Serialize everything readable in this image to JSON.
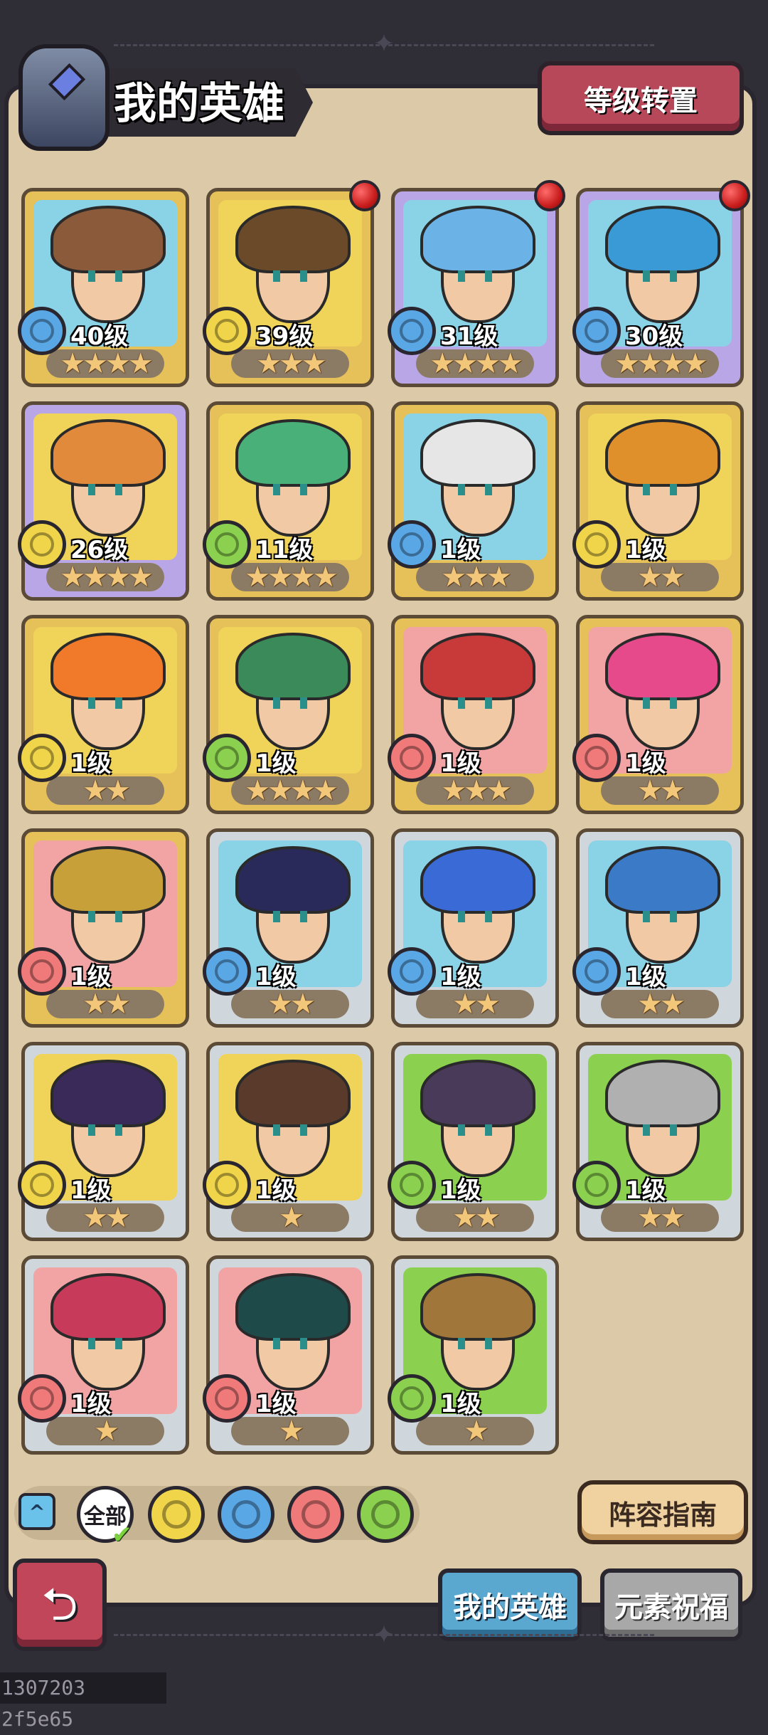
{
  "header": {
    "title": "我的英雄",
    "level_transfer_button": "等级转置"
  },
  "elements": {
    "earth": {
      "color": "#f0d54a",
      "icon": "earth-swirl-icon"
    },
    "water": {
      "color": "#5aa7e6",
      "icon": "water-drop-icon"
    },
    "fire": {
      "color": "#f07a7a",
      "icon": "fire-flame-icon"
    },
    "wind": {
      "color": "#8bd14f",
      "icon": "wind-swirl-icon"
    }
  },
  "heroes": [
    {
      "level": "40级",
      "stars": "★★★★",
      "element": "water",
      "bg": "#8ad2e6",
      "hair": "#8a5a3a",
      "frame": "#e6c15a",
      "red_dot": false
    },
    {
      "level": "39级",
      "stars": "★★★",
      "element": "earth",
      "bg": "#f0d45a",
      "hair": "#6b4a2a",
      "frame": "#e6c15a",
      "red_dot": true
    },
    {
      "level": "31级",
      "stars": "★★★★",
      "element": "water",
      "bg": "#8ad2e6",
      "hair": "#6bb3e6",
      "frame": "#b9a6e6",
      "red_dot": true
    },
    {
      "level": "30级",
      "stars": "★★★★",
      "element": "water",
      "bg": "#8ad2e6",
      "hair": "#3a9ad6",
      "frame": "#b9a6e6",
      "red_dot": true
    },
    {
      "level": "26级",
      "stars": "★★★★",
      "element": "earth",
      "bg": "#f0d45a",
      "hair": "#e28a3c",
      "frame": "#b9a6e6",
      "red_dot": false
    },
    {
      "level": "11级",
      "stars": "★★★★",
      "element": "wind",
      "bg": "#f0d45a",
      "hair": "#4ab07a",
      "frame": "#e6c15a",
      "red_dot": false
    },
    {
      "level": "1级",
      "stars": "★★★",
      "element": "water",
      "bg": "#8ad2e6",
      "hair": "#e6e6e6",
      "frame": "#e6c15a",
      "red_dot": false
    },
    {
      "level": "1级",
      "stars": "★★",
      "element": "earth",
      "bg": "#f0d45a",
      "hair": "#e0902a",
      "frame": "#e6c15a",
      "red_dot": false
    },
    {
      "level": "1级",
      "stars": "★★",
      "element": "earth",
      "bg": "#f0d45a",
      "hair": "#f07a2a",
      "frame": "#e6c15a",
      "red_dot": false
    },
    {
      "level": "1级",
      "stars": "★★★★",
      "element": "wind",
      "bg": "#f0d45a",
      "hair": "#3a8a5a",
      "frame": "#e6c15a",
      "red_dot": false
    },
    {
      "level": "1级",
      "stars": "★★★",
      "element": "fire",
      "bg": "#f2a4a4",
      "hair": "#c83a3a",
      "frame": "#e6c15a",
      "red_dot": false
    },
    {
      "level": "1级",
      "stars": "★★",
      "element": "fire",
      "bg": "#f2a4a4",
      "hair": "#e64a8a",
      "frame": "#e6c15a",
      "red_dot": false
    },
    {
      "level": "1级",
      "stars": "★★",
      "element": "fire",
      "bg": "#f2a4a4",
      "hair": "#c8a03a",
      "frame": "#e6c15a",
      "red_dot": false
    },
    {
      "level": "1级",
      "stars": "★★",
      "element": "water",
      "bg": "#8ad2e6",
      "hair": "#2a2a5a",
      "frame": "#cfd6dc",
      "red_dot": false
    },
    {
      "level": "1级",
      "stars": "★★",
      "element": "water",
      "bg": "#8ad2e6",
      "hair": "#3a6ad6",
      "frame": "#cfd6dc",
      "red_dot": false
    },
    {
      "level": "1级",
      "stars": "★★",
      "element": "water",
      "bg": "#8ad2e6",
      "hair": "#3a7ac6",
      "frame": "#cfd6dc",
      "red_dot": false
    },
    {
      "level": "1级",
      "stars": "★★",
      "element": "earth",
      "bg": "#f0d45a",
      "hair": "#3a2a5a",
      "frame": "#cfd6dc",
      "red_dot": false
    },
    {
      "level": "1级",
      "stars": "★",
      "element": "earth",
      "bg": "#f0d45a",
      "hair": "#5a3a2a",
      "frame": "#cfd6dc",
      "red_dot": false
    },
    {
      "level": "1级",
      "stars": "★★",
      "element": "wind",
      "bg": "#8bd14f",
      "hair": "#4a3a5a",
      "frame": "#cfd6dc",
      "red_dot": false
    },
    {
      "level": "1级",
      "stars": "★★",
      "element": "wind",
      "bg": "#8bd14f",
      "hair": "#b0b0b0",
      "frame": "#cfd6dc",
      "red_dot": false
    },
    {
      "level": "1级",
      "stars": "★",
      "element": "fire",
      "bg": "#f2a4a4",
      "hair": "#c83a5a",
      "frame": "#cfd6dc",
      "red_dot": false
    },
    {
      "level": "1级",
      "stars": "★",
      "element": "fire",
      "bg": "#f2a4a4",
      "hair": "#1f4a4a",
      "frame": "#cfd6dc",
      "red_dot": false
    },
    {
      "level": "1级",
      "stars": "★",
      "element": "wind",
      "bg": "#8bd14f",
      "hair": "#a0763a",
      "frame": "#cfd6dc",
      "red_dot": false
    }
  ],
  "filters": {
    "all_label": "全部",
    "collapse_icon": "chevron-up-icon"
  },
  "guide_button": "阵容指南",
  "tabs": {
    "my_heroes": "我的英雄",
    "element_blessing": "元素祝福"
  },
  "back_icon": "back-arrow-icon",
  "footer_id": "1307203 2f5e65"
}
